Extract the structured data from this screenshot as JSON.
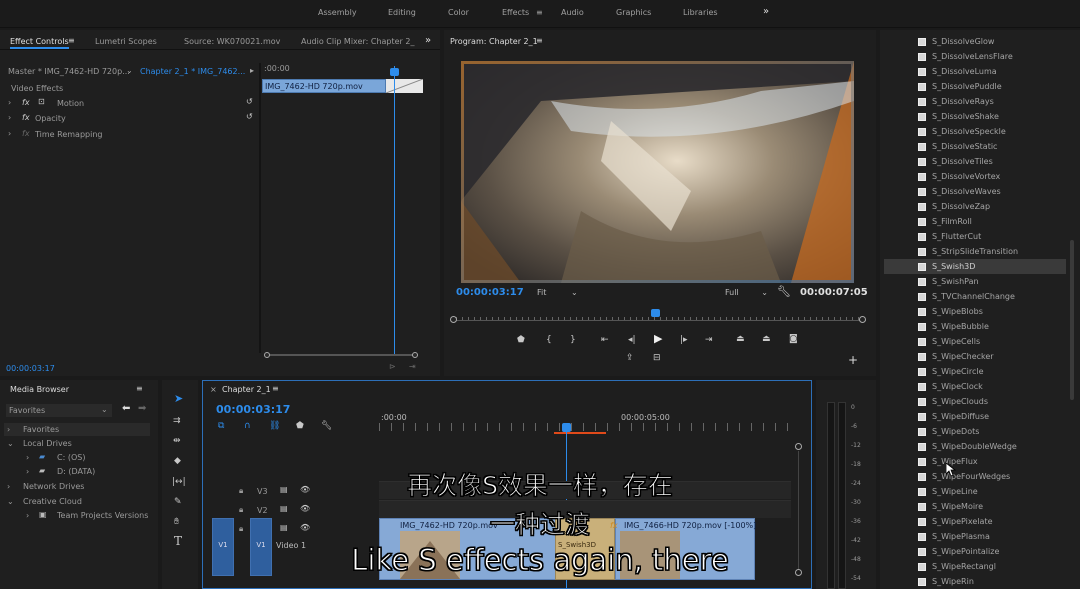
{
  "workspaces": {
    "items": [
      "Assembly",
      "Editing",
      "Color",
      "Effects",
      "Audio",
      "Graphics",
      "Libraries"
    ],
    "active": "Effects",
    "more": "»",
    "menu_icon": "≡"
  },
  "effect_controls": {
    "tabs": [
      "Effect Controls",
      "Lumetri Scopes",
      "Source: WK070021.mov",
      "Audio Clip Mixer: Chapter 2_"
    ],
    "menu_icon": "≡",
    "overflow": "»",
    "master": "Master * IMG_7462-HD 720p...",
    "sequence_clip": "Chapter 2_1 * IMG_7462...",
    "video_effects": "Video Effects",
    "rows": [
      "Motion",
      "Opacity",
      "Time Remapping"
    ],
    "timecode_ruler": ":00:00",
    "clip": "IMG_7462-HD 720p.mov",
    "timecode": "00:00:03:17"
  },
  "program": {
    "title": "Program: Chapter 2_1",
    "menu_icon": "≡",
    "timecode": "00:00:03:17",
    "fit": "Fit",
    "quality": "Full",
    "duration": "00:00:07:05"
  },
  "media_browser": {
    "title": "Media Browser",
    "menu_icon": "≡",
    "dropdown": "Favorites",
    "tree": [
      {
        "label": "Favorites",
        "indent": 0
      },
      {
        "label": "Local Drives",
        "indent": 0
      },
      {
        "label": "C: (OS)",
        "indent": 1
      },
      {
        "label": "D: (DATA)",
        "indent": 1
      },
      {
        "label": "Network Drives",
        "indent": 0
      },
      {
        "label": "Creative Cloud",
        "indent": 0
      },
      {
        "label": "Team Projects Versions",
        "indent": 1
      }
    ]
  },
  "timeline": {
    "title": "Chapter 2_1",
    "menu_icon": "≡",
    "close": "×",
    "timecode": "00:00:03:17",
    "ruler": [
      ":00:00",
      "00:00:05:00"
    ],
    "tracks": [
      "V3",
      "V2",
      "V1"
    ],
    "track_name": "Video 1",
    "clip1": "IMG_7462-HD 720p.mov",
    "clip2": "IMG_7466-HD 720p.mov [-100%]",
    "clip_fx": "fx",
    "mid_label": "S_Swish3D"
  },
  "audio_meter": {
    "labels": [
      "0",
      "-6",
      "-12",
      "-18",
      "-24",
      "-30",
      "-36",
      "-42",
      "-48",
      "-54"
    ]
  },
  "effects_list": {
    "items": [
      "S_DissolveGlow",
      "S_DissolveLensFlare",
      "S_DissolveLuma",
      "S_DissolvePuddle",
      "S_DissolveRays",
      "S_DissolveShake",
      "S_DissolveSpeckle",
      "S_DissolveStatic",
      "S_DissolveTiles",
      "S_DissolveVortex",
      "S_DissolveWaves",
      "S_DissolveZap",
      "S_FilmRoll",
      "S_FlutterCut",
      "S_StripSlideTransition",
      "S_Swish3D",
      "S_SwishPan",
      "S_TVChannelChange",
      "S_WipeBlobs",
      "S_WipeBubble",
      "S_WipeCells",
      "S_WipeChecker",
      "S_WipeCircle",
      "S_WipeClock",
      "S_WipeClouds",
      "S_WipeDiffuse",
      "S_WipeDots",
      "S_WipeDoubleWedge",
      "S_WipeFlux",
      "S_WipeFourWedges",
      "S_WipeLine",
      "S_WipeMoire",
      "S_WipePixelate",
      "S_WipePlasma",
      "S_WipePointalize",
      "S_WipeRectangl",
      "S_WipeRin"
    ],
    "selected": "S_Swish3D"
  },
  "subtitles": {
    "line1": "再次像S效果一样，存在",
    "line2": "一种过渡",
    "line3": "Like S effects again, there"
  },
  "colors": {
    "accent": "#2d8ceb",
    "playhead": "#2d8ceb",
    "selection": "#3a3a3a"
  }
}
